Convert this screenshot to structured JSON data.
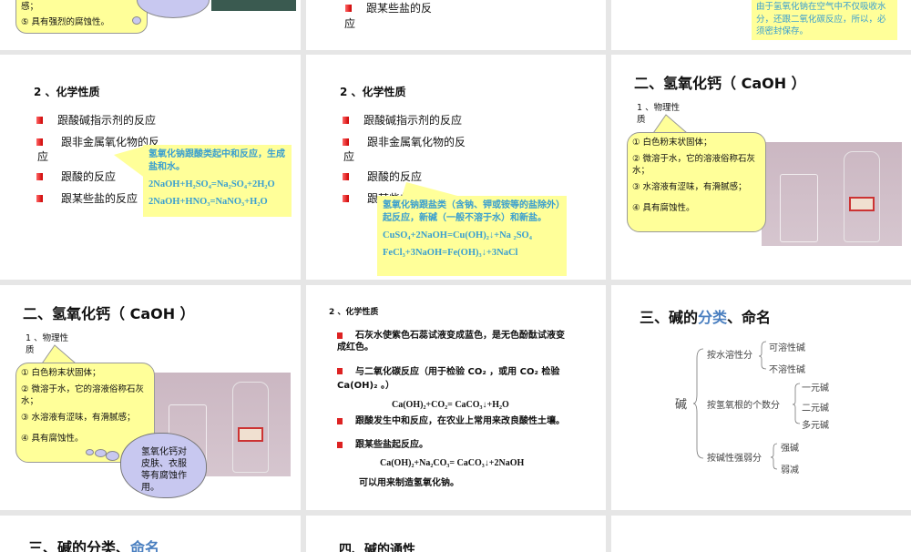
{
  "row0": {
    "s1_lines": [
      "感；",
      "⑤ 具有强烈的腐蚀性。"
    ],
    "s2_lines": [
      "跟某些盐的反",
      "应"
    ],
    "s3_note": "由于氢氧化钠在空气中不仅吸收水分，还跟二氧化碳反应，所以，必须密封保存。"
  },
  "naoh_chem": {
    "heading": "2 、化学性质",
    "bullets": [
      "跟酸碱指示剂的反应",
      "跟非金属氧化物的反",
      "应",
      "跟酸的反应",
      "跟某些盐的反应"
    ],
    "note_acid": {
      "text": "氢氧化钠跟酸类起中和反应，生成盐和水。",
      "eq1": "2NaOH+H₂SO₄=Na₂SO₄+2H₂O",
      "eq2": "2NaOH+HNO₃=NaNO₃+H₂O"
    },
    "note_salt": {
      "text": "氢氧化钠跟盐类（含钠、钾或铵等的盐除外）起反应，新碱（一般不溶于水）和新盐。",
      "eq1": "CuSO₄+2NaOH=Cu(OH)₂↓+Na ₂SO₄",
      "eq2": "FeCl₃+3NaOH=Fe(OH)₃↓+3NaCl"
    }
  },
  "caoh_phys": {
    "title": "二、氢氧化钙（ CaOH ）",
    "sub": "1 、物理性质",
    "items": [
      "① 白色粉末状固体；",
      "② 微溶于水，它的溶液俗称石灰水；",
      "③ 水溶液有涩味，有滑腻感；",
      "④ 具有腐蚀性。"
    ],
    "cloud": "氢氧化钙对皮肤、衣服等有腐蚀作用。"
  },
  "caoh_chem": {
    "heading": "2 、化学性质",
    "b1": "石灰水使紫色石蕊试液变成蓝色，是无色酚酞试液变成红色。",
    "b2": "与二氧化碳反应（用于检验 CO₂ ，或用 CO₂ 检验 Ca(OH)₂ 。）",
    "eq1": "Ca(OH)₂+CO₂= CaCO₃↓+H₂O",
    "b3": "跟酸发生中和反应，在农业上常用来改良酸性土壤。",
    "b4": "跟某些盐起反应。",
    "eq2": "Ca(OH)₂+Na₂CO₃= CaCO₃↓+2NaOH",
    "tail": "可以用来制造氢氧化钠。"
  },
  "classify": {
    "title_a": "三、碱的",
    "title_b": "分类",
    "title_c": "、命名",
    "root": "碱",
    "groups": [
      "按水溶性分",
      "按氢氧根的个数分",
      "按碱性强弱分"
    ],
    "leaves": [
      "可溶性碱",
      "不溶性碱",
      "一元碱",
      "二元碱",
      "多元碱",
      "强碱",
      "弱减"
    ]
  },
  "row3": {
    "title_a": "三、碱的分类、",
    "title_b": "命名",
    "title2": "四、碱的通性"
  },
  "colors": {
    "accent_blue": "#4a7fc0",
    "note_yellow": "#ffff99",
    "note_text": "#3a9fd0"
  }
}
